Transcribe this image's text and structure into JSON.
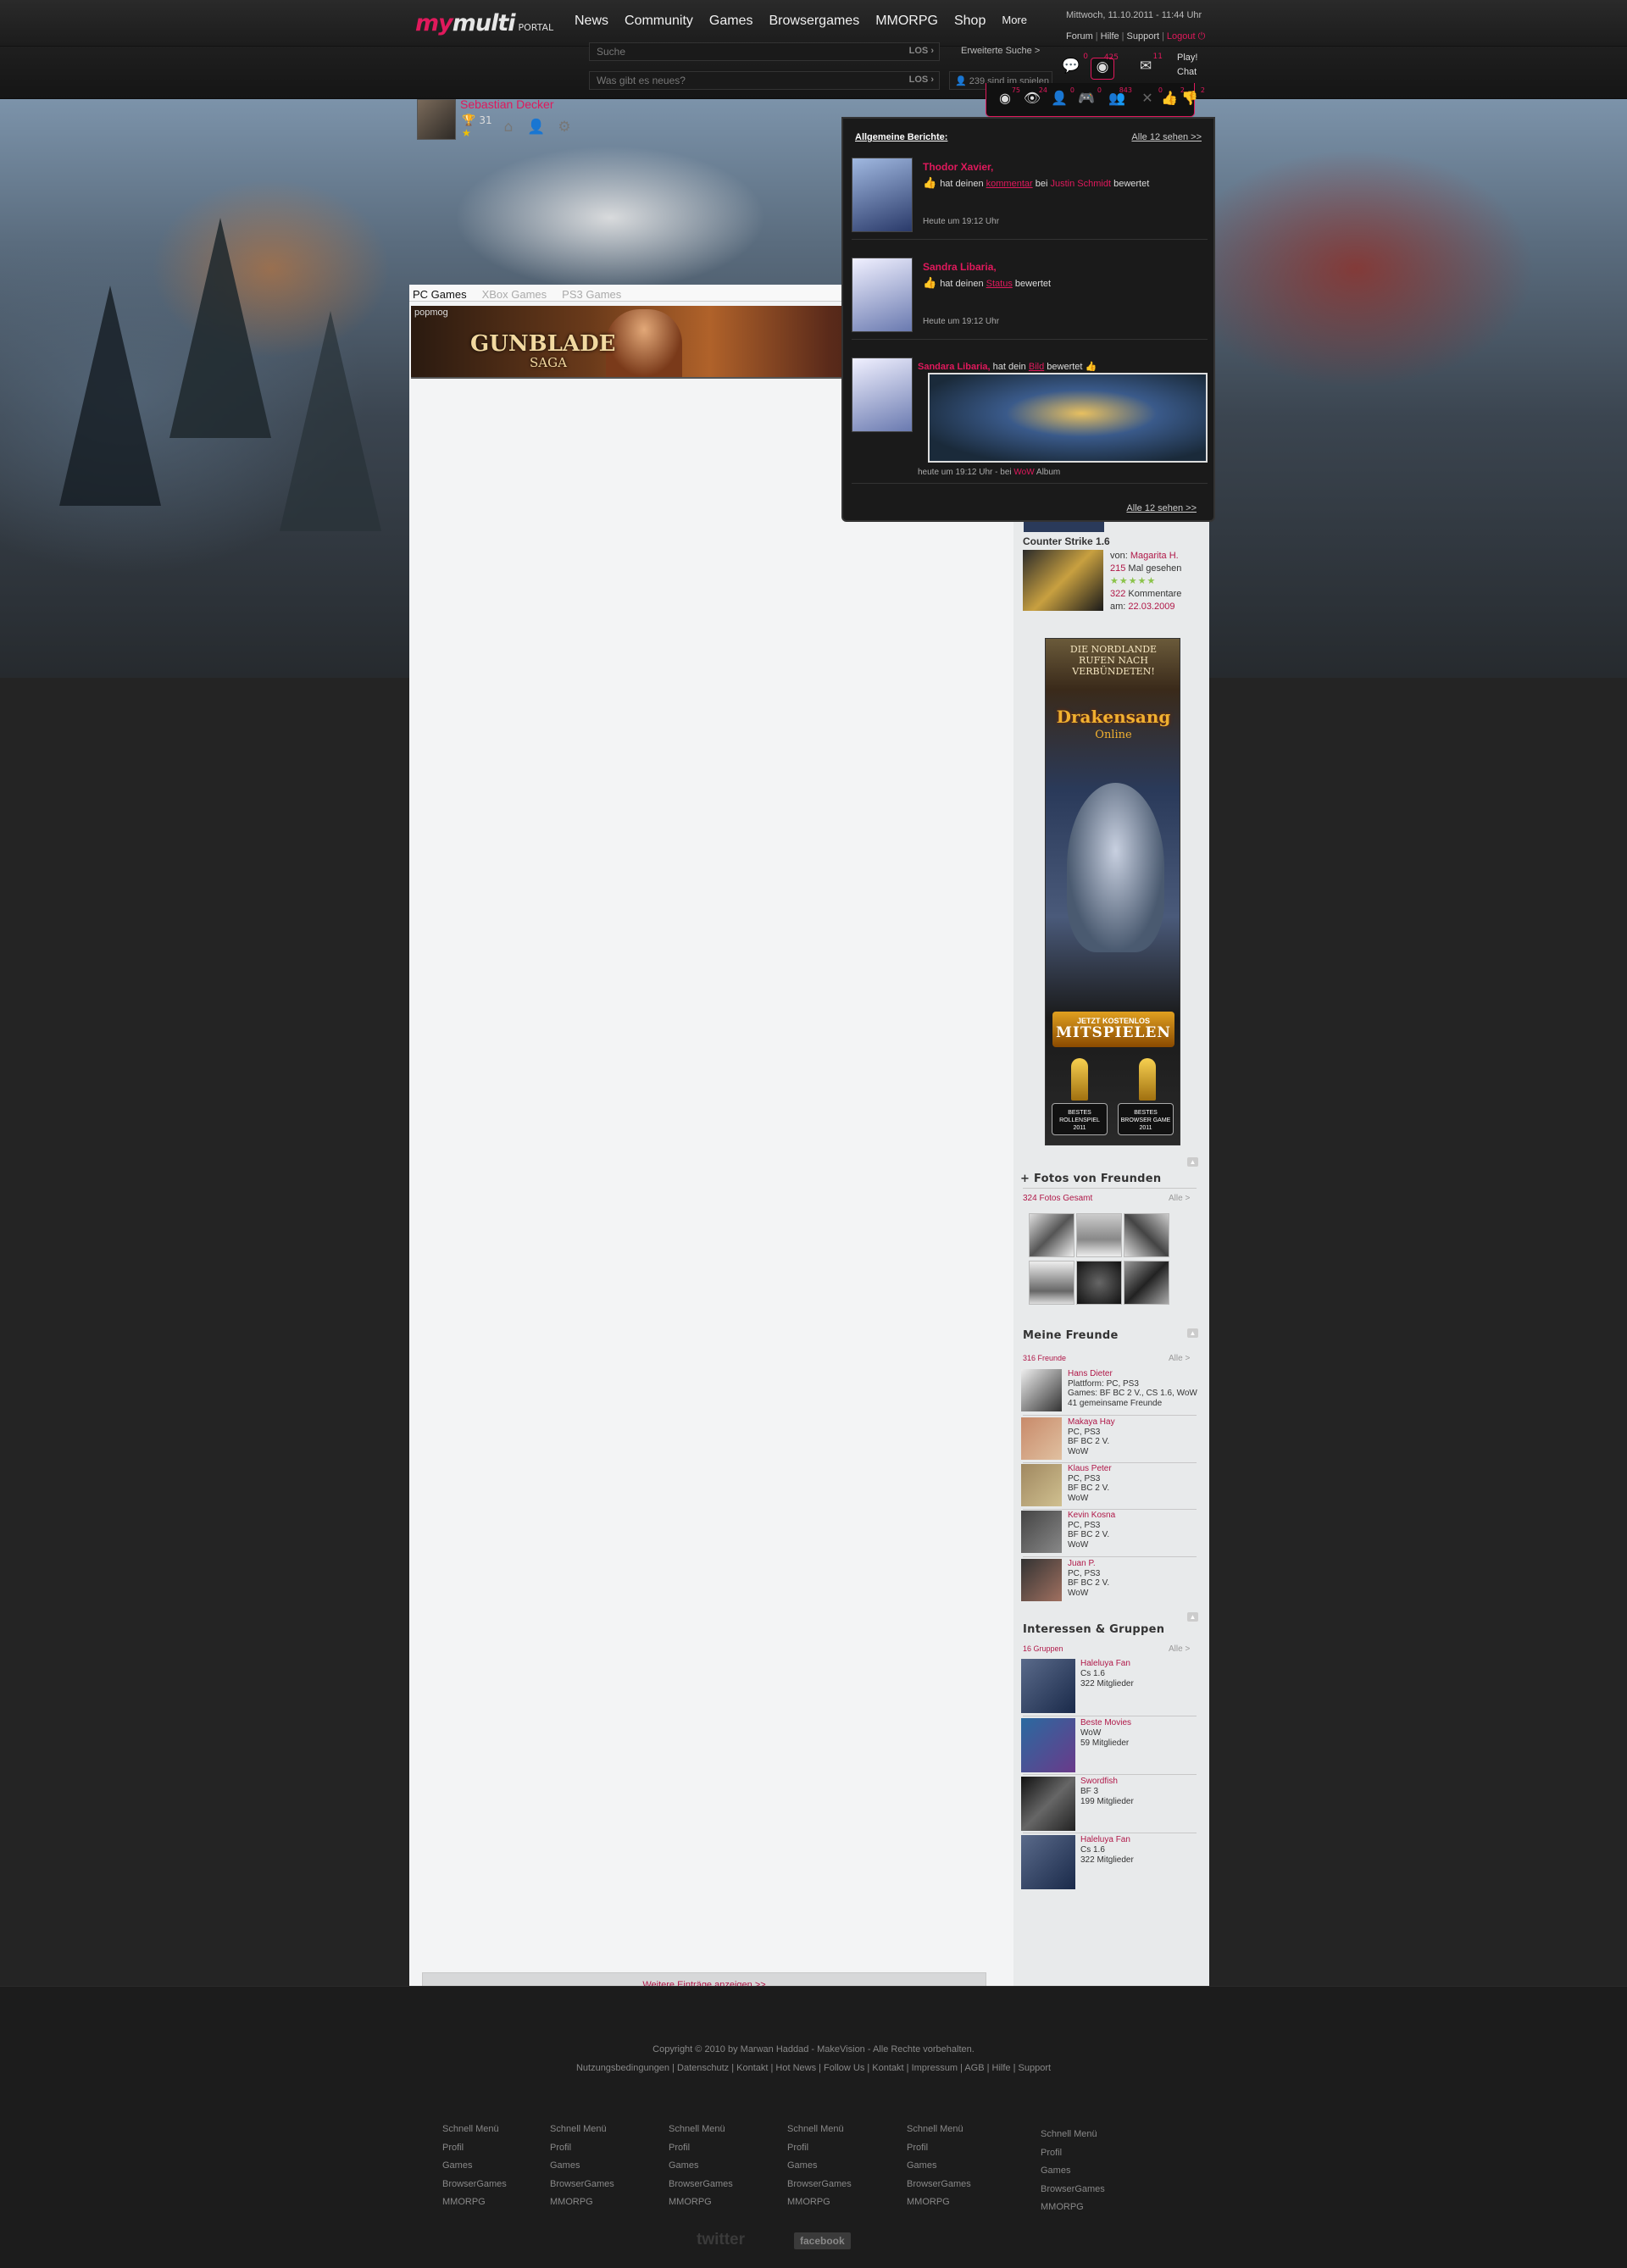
{
  "header": {
    "logo_my": "my",
    "logo_multi": "multi",
    "logo_portal": "PORTAL",
    "nav": [
      "News",
      "Community",
      "Games",
      "Browsergames",
      "MMORPG",
      "Shop",
      "More"
    ],
    "datetime": "Mittwoch, 11.10.2011 - 11:44 Uhr",
    "links": [
      "Forum",
      "Hilfe",
      "Support"
    ],
    "logout": "Logout",
    "user_name": "Sebastian Decker",
    "user_points": "31",
    "search_placeholder": "Suche",
    "search_button": "LOS",
    "advanced_search": "Erweiterte Suche >",
    "status_placeholder": "Was gibt es neues?",
    "status_button": "LOS",
    "online_text": "239 sind im spielen",
    "play_label": "Play!",
    "chat_label": "Chat",
    "top_icons": [
      {
        "icon": "chat-bubble-icon",
        "count": "0"
      },
      {
        "icon": "broadcast-icon",
        "count": "425"
      },
      {
        "icon": "mail-icon",
        "count": "11"
      }
    ],
    "sub_icons": [
      {
        "icon": "broadcast-icon",
        "count": "75"
      },
      {
        "icon": "eye-icon",
        "count": "24"
      },
      {
        "icon": "friend-request-icon",
        "count": "0"
      },
      {
        "icon": "gamepad-icon",
        "count": "0"
      },
      {
        "icon": "group-icon",
        "count": "843"
      },
      {
        "icon": "close-icon",
        "count": "0"
      },
      {
        "icon": "thumbs-up-icon",
        "count": "2"
      },
      {
        "icon": "thumbs-down-icon",
        "count": "2"
      }
    ]
  },
  "main": {
    "tabs": [
      "PC Games",
      "XBox Games",
      "PS3 Games"
    ],
    "banner_brand": "popmog",
    "banner_title": "GUNBLADE",
    "banner_subtitle": "SAGA",
    "more_entries": "Weitere Einträge anzeigen >>"
  },
  "popup": {
    "heading": "Allgemeine Berichte:",
    "see_all": "Alle 12 sehen >>",
    "items": [
      {
        "name": "Thodor Xavier,",
        "pre": "hat deinen",
        "link1": "kommentar",
        "mid": "bei",
        "link2": "Justin Schmidt",
        "post": "bewertet",
        "time": "Heute um 19:12 Uhr"
      },
      {
        "name": "Sandra Libaria,",
        "pre": "hat deinen",
        "link1": "Status",
        "post": "bewertet",
        "time": "Heute um 19:12 Uhr"
      },
      {
        "name": "Sandara Libaria,",
        "pre": "hat dein",
        "link1": "Bild",
        "post": "bewertet",
        "time_pre": "heute um 19:12 Uhr - bei",
        "time_link": "WoW",
        "time_post": "Album"
      }
    ],
    "footer_link": "Alle 12 sehen >>"
  },
  "sidebar": {
    "prev_date": "am: 22.03.2009",
    "game": {
      "title": "Counter Strike 1.6",
      "by_label": "von:",
      "by": "Magarita H.",
      "views": "215",
      "views_label": "Mal gesehen",
      "stars": "★★★★★",
      "comments": "322",
      "comments_label": "Kommentare",
      "date_label": "am:",
      "date": "22.03.2009"
    },
    "ad": {
      "headline": "DIE NORDLANDE RUFEN NACH VERBÜNDETEN!",
      "logo": "Drakensang",
      "logo_sub": "Online",
      "cta_small": "JETZT KOSTENLOS",
      "cta_big": "MITSPIELEN",
      "award1": "BESTES ROLLENSPIEL 2011",
      "award2": "BESTES BROWSER GAME 2011"
    },
    "photos": {
      "title": "+ Fotos von Freunden",
      "count": "324 Fotos Gesamt",
      "all": "Alle >"
    },
    "friends": {
      "title": "Meine Freunde",
      "count": "316 Freunde",
      "all": "Alle >",
      "items": [
        {
          "name": "Hans Dieter",
          "l1": "Plattform: PC, PS3",
          "l2": "Games: BF BC 2 V., CS 1.6, WoW",
          "l3": "41 gemeinsame Freunde"
        },
        {
          "name": "Makaya Hay",
          "l1": "PC, PS3",
          "l2": "BF BC 2 V.",
          "l3": "WoW"
        },
        {
          "name": "Klaus Peter",
          "l1": "PC, PS3",
          "l2": "BF BC 2 V.",
          "l3": "WoW"
        },
        {
          "name": "Kevin Kosna",
          "l1": "PC, PS3",
          "l2": "BF BC 2 V.",
          "l3": "WoW"
        },
        {
          "name": "Juan P.",
          "l1": "PC, PS3",
          "l2": "BF BC 2 V.",
          "l3": "WoW"
        }
      ]
    },
    "groups": {
      "title": "Interessen & Gruppen",
      "count": "16 Gruppen",
      "all": "Alle >",
      "items": [
        {
          "name": "Haleluya Fan",
          "l1": "Cs 1.6",
          "l2": "322 Mitglieder"
        },
        {
          "name": "Beste Movies",
          "l1": "WoW",
          "l2": "59 Mitglieder"
        },
        {
          "name": "Swordfish",
          "l1": "BF 3",
          "l2": "199 Mitglieder"
        },
        {
          "name": "Haleluya Fan",
          "l1": "Cs 1.6",
          "l2": "322 Mitglieder"
        }
      ]
    }
  },
  "footer": {
    "copyright": "Copyright © 2010 by Marwan Haddad - MakeVision - Alle Rechte vorbehalten.",
    "links": "Nutzungsbedingungen | Datenschutz | Kontakt | Hot News | Follow Us | Kontakt | Impressum | AGB | Hilfe | Support",
    "columns": [
      [
        "Schnell Menü",
        "Profil",
        "Games",
        "BrowserGames",
        "MMORPG"
      ],
      [
        "Schnell Menü",
        "Profil",
        "Games",
        "BrowserGames",
        "MMORPG"
      ],
      [
        "Schnell Menü",
        "Profil",
        "Games",
        "BrowserGames",
        "MMORPG"
      ],
      [
        "Schnell Menü",
        "Profil",
        "Games",
        "BrowserGames",
        "MMORPG"
      ],
      [
        "Schnell Menü",
        "Profil",
        "Games",
        "BrowserGames",
        "MMORPG"
      ],
      [
        "Schnell Menü",
        "Profil",
        "Games",
        "BrowserGames",
        "MMORPG"
      ]
    ],
    "twitter": "twitter",
    "facebook": "facebook"
  },
  "colors": {
    "accent": "#e0195c",
    "link": "#b01848"
  }
}
